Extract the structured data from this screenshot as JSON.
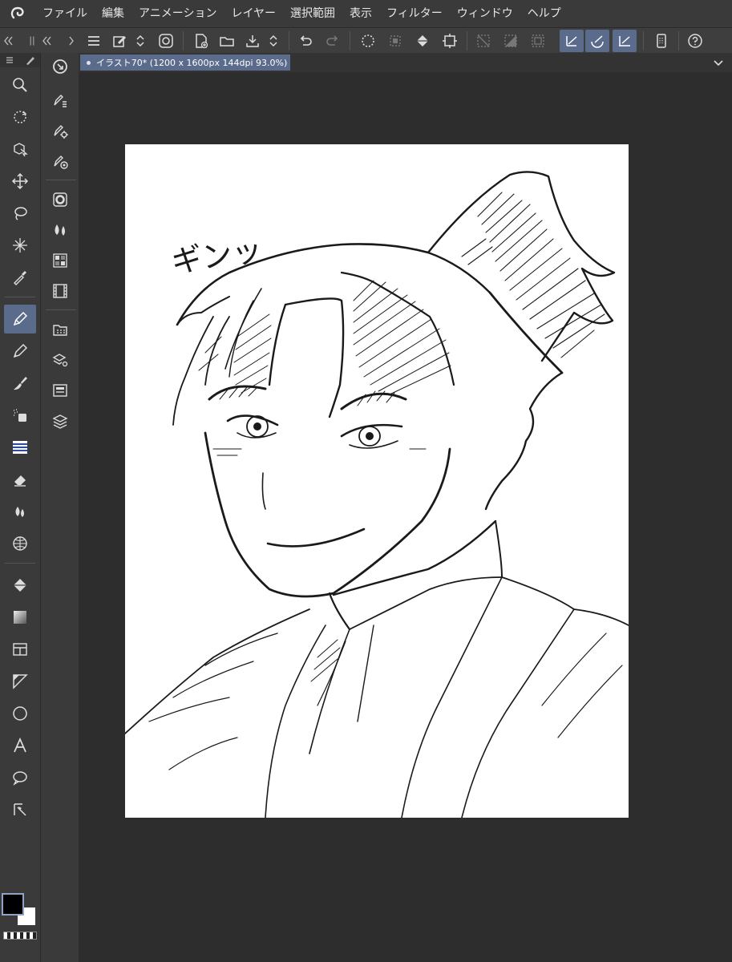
{
  "app": {
    "logo_icon": "clip-studio-logo-icon"
  },
  "menu": {
    "items": [
      "ファイル",
      "編集",
      "アニメーション",
      "レイヤー",
      "選択範囲",
      "表示",
      "フィルター",
      "ウィンドウ",
      "ヘルプ"
    ]
  },
  "document_tab": {
    "label": "イラスト70* (1200 x 1600px 144dpi 93.0%)"
  },
  "canvas": {
    "sfx_text": "ギンッ"
  },
  "colors": {
    "accent": "#5b6b8c",
    "main_color": "#000000",
    "sub_color": "#ffffff",
    "ui_dark": "#2d2d2d",
    "ui_panel": "#3a3a3a"
  }
}
